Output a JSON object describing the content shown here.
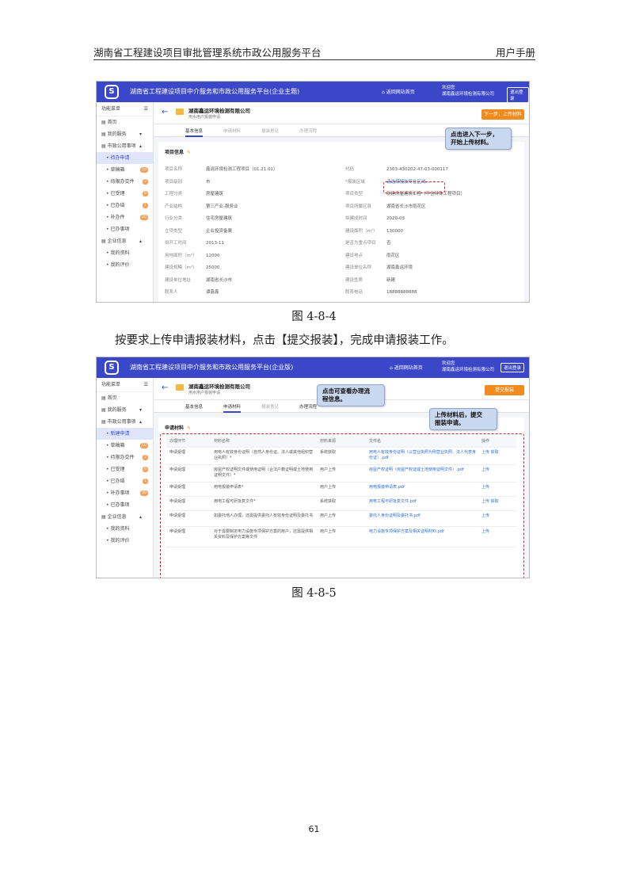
{
  "header": {
    "left": "湖南省工程建设项目审批管理系统市政公用服务平台",
    "right": "用户手册"
  },
  "shot1": {
    "app_title": "湖南省工程建设项目中介服务和市政公用服务平台(企业主题)",
    "home": "返回网站首页",
    "user_line1": "欢迎您",
    "user_line2": "湖南鑫运环境检测有限公司",
    "logout": "退出登录",
    "menu_title": "功能菜单",
    "menu_toggle": "☰",
    "menu": [
      {
        "label": "首页",
        "level": 0
      },
      {
        "label": "我的服务",
        "level": 0,
        "arrow": "▾"
      },
      {
        "label": "市政公用事项",
        "level": 0,
        "arrow": "▴"
      },
      {
        "label": "待办申请",
        "level": 1,
        "active": true
      },
      {
        "label": "草稿箱",
        "level": 1,
        "badge": "10"
      },
      {
        "label": "待限办交件",
        "level": 1,
        "badge": "2"
      },
      {
        "label": "已受理",
        "level": 1,
        "badge": "6"
      },
      {
        "label": "已办结",
        "level": 1,
        "badge": "1"
      },
      {
        "label": "补办件",
        "level": 1,
        "badge": "20"
      },
      {
        "label": "已办事项",
        "level": 1
      },
      {
        "label": "企业信息",
        "level": 0,
        "arrow": "▴"
      },
      {
        "label": "我的资料",
        "level": 1
      },
      {
        "label": "我的评价",
        "level": 1
      }
    ],
    "company": "湖南鑫运环境检测有限公司",
    "company_sub": "用水用户报装申请",
    "next_btn": "下一步，上传材料",
    "tabs": [
      "基本信息",
      "申请材料",
      "报装意见",
      "办理流程"
    ],
    "panel_title": "项目信息",
    "pencil": "✎",
    "left_fields": [
      {
        "k": "项目名称",
        "v": "鑫运环境检测工程项目（01.21.01）"
      },
      {
        "k": "项目级别",
        "v": "市"
      },
      {
        "k": "工程分类",
        "v": "房屋建筑"
      },
      {
        "k": "产业结构",
        "v": "第三产业-服务业"
      },
      {
        "k": "行业分类",
        "v": "住宅房屋建筑"
      },
      {
        "k": "立项类型",
        "v": "企业投资备案"
      },
      {
        "k": "拟开工时间",
        "v": "2013-11"
      },
      {
        "k": "用地面积（m²）",
        "v": "12000"
      },
      {
        "k": "建设规模（m²）",
        "v": "25000"
      },
      {
        "k": "建设单位地址",
        "v": "湖南省长沙市"
      },
      {
        "k": "联系人",
        "v": "谭鑫鑫"
      }
    ],
    "right_fields": [
      {
        "k": "代码",
        "v": "2303-430202-47-03-000117"
      },
      {
        "k": "*报装区域",
        "v": "请选择报装所在区域..."
      },
      {
        "k": "项目类型",
        "v": "新建房屋建筑工程（不含特殊工程项目）"
      },
      {
        "k": "项目所属区县",
        "v": "湖南省长沙市雨花区"
      },
      {
        "k": "拟建成时间",
        "v": "2020-03"
      },
      {
        "k": "建设面积（m²）",
        "v": "130000"
      },
      {
        "k": "是否为重点项目",
        "v": "否"
      },
      {
        "k": "建设地点",
        "v": "雨花区"
      },
      {
        "k": "建设单位名称",
        "v": "湖南鑫运环境"
      },
      {
        "k": "建设性质",
        "v": "新建"
      },
      {
        "k": "联系电话",
        "v": "18888888888"
      }
    ],
    "callout": [
      "点击进入下一步，",
      "开始上传材料。"
    ]
  },
  "caption1": "图 4-8-4",
  "para": "按要求上传申请报装材料，点击【提交报装】，完成申请报装工作。",
  "shot2": {
    "app_title": "湖南省工程建设项目中介服务和市政公用服务平台(企业版)",
    "home": "返回网站首页",
    "user_line1": "欢迎您",
    "user_line2": "湖南鑫运环境检测有限公司",
    "logout": "退出登录",
    "menu_title": "功能菜单",
    "menu_toggle": "☰",
    "menu": [
      {
        "label": "首页",
        "level": 0
      },
      {
        "label": "我的服务",
        "level": 0,
        "arrow": "▾"
      },
      {
        "label": "市政公用事项",
        "level": 0,
        "arrow": "▴"
      },
      {
        "label": "新建申请",
        "level": 1,
        "active": true
      },
      {
        "label": "草稿箱",
        "level": 1,
        "badge": "10"
      },
      {
        "label": "待限办交件",
        "level": 1,
        "badge": "2"
      },
      {
        "label": "已受理",
        "level": 1,
        "badge": "6"
      },
      {
        "label": "已办结",
        "level": 1,
        "badge": "1"
      },
      {
        "label": "补办事项",
        "level": 1,
        "badge": "20"
      },
      {
        "label": "已办事项",
        "level": 1
      },
      {
        "label": "企业信息",
        "level": 0,
        "arrow": "▴"
      },
      {
        "label": "我的资料",
        "level": 1
      },
      {
        "label": "我的评价",
        "level": 1
      }
    ],
    "company": "湖南鑫运环境检测有限公司",
    "company_sub": "用水用户报装申请",
    "submit_btn": "提交报装",
    "tabs": [
      "基本信息",
      "申请材料",
      "报装意见",
      "办理流程"
    ],
    "panel_title": "申请材料",
    "pencil": "✎",
    "columns": [
      "办理环节",
      "材料名称",
      "材料来源",
      "文件名",
      "操作"
    ],
    "rows": [
      {
        "stage": "申请受理",
        "name": "用电人有效身份证明（自然人身份证、法人或其他组织营业执照）*",
        "src": "系统获取",
        "file": "用电人有效身份证明（以营业执照为例营业执照、法人代表身份证）.pdf",
        "ops": "上传 获取"
      },
      {
        "stage": "申请受理",
        "name": "房屋产权证明文件或使用证明（合法户籍证明或土地使用证明文件）*",
        "src": "用户上传",
        "file": "房屋产权证明（房屋产权证或土地使用证明文件）.pdf",
        "ops": "上传"
      },
      {
        "stage": "申请受理",
        "name": "用电报装申请表*",
        "src": "用户上传",
        "file": "用电报装申请表.pdf",
        "ops": "上传"
      },
      {
        "stage": "申请受理",
        "name": "用电工程可研批复文件*",
        "src": "系统获取",
        "file": "用电工程可研批复文件.pdf",
        "ops": "上传 获取"
      },
      {
        "stage": "申请受理",
        "name": "如委托他人办理，还需提供委托人有效身份证明及委托书",
        "src": "用户上传",
        "file": "委托人身份证明及委托书.pdf",
        "ops": "上传"
      },
      {
        "stage": "申请受理",
        "name": "对于需要制定电力设施专项保护方案的用户，还需提供相关资料及保护方案等文件",
        "src": "用户上传",
        "file": "电力设施专项保护方案及相关证明材料.pdf",
        "ops": "上传"
      }
    ],
    "callout_top": [
      "点击可查看办理流",
      "程信息。"
    ],
    "callout_right": [
      "上传材料后，提交",
      "报装申请。"
    ]
  },
  "caption2": "图 4-8-5",
  "page_number": "61"
}
